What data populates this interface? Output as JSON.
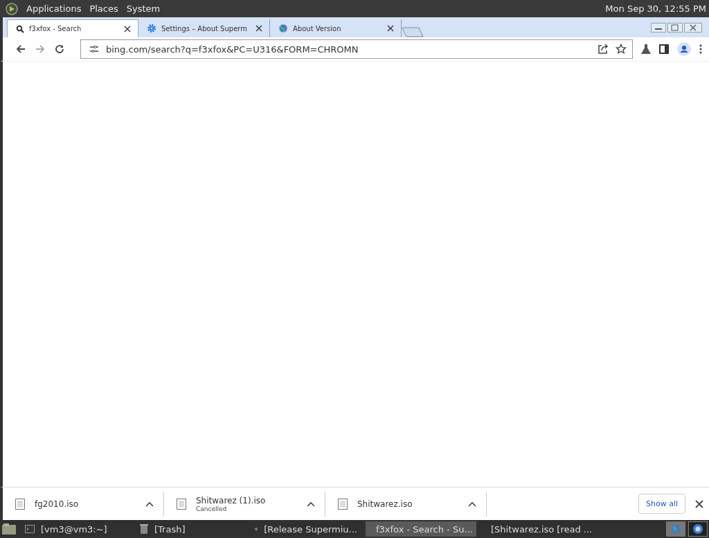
{
  "top_panel": {
    "menus": [
      "Applications",
      "Places",
      "System"
    ],
    "clock": "Mon Sep 30, 12:55 PM"
  },
  "tabs": [
    {
      "title": "f3xfox - Search",
      "kind": "search",
      "selected": true
    },
    {
      "title": "Settings – About Superm",
      "kind": "settings",
      "selected": false
    },
    {
      "title": "About Version",
      "kind": "page",
      "selected": false
    }
  ],
  "address_bar": {
    "url": "bing.com/search?q=f3xfox&PC=U316&FORM=CHROMN"
  },
  "downloads": [
    {
      "name": "fg2010.iso"
    },
    {
      "name": "Shitwarez (1).iso",
      "status": "Cancelled"
    },
    {
      "name": "Shitwarez.iso"
    }
  ],
  "show_all": "Show all",
  "taskbar": [
    {
      "label": "[vm3@vm3:~]",
      "kind": "terminal",
      "selected": false
    },
    {
      "label": "[Trash]",
      "kind": "trash",
      "selected": false
    },
    {
      "label": "[Release Supermiu...",
      "kind": "browser",
      "selected": false
    },
    {
      "label": "f3xfox - Search - Su...",
      "kind": "browser",
      "selected": true
    },
    {
      "label": "[Shitwarez.iso [read ...",
      "kind": "disk",
      "selected": false
    }
  ]
}
